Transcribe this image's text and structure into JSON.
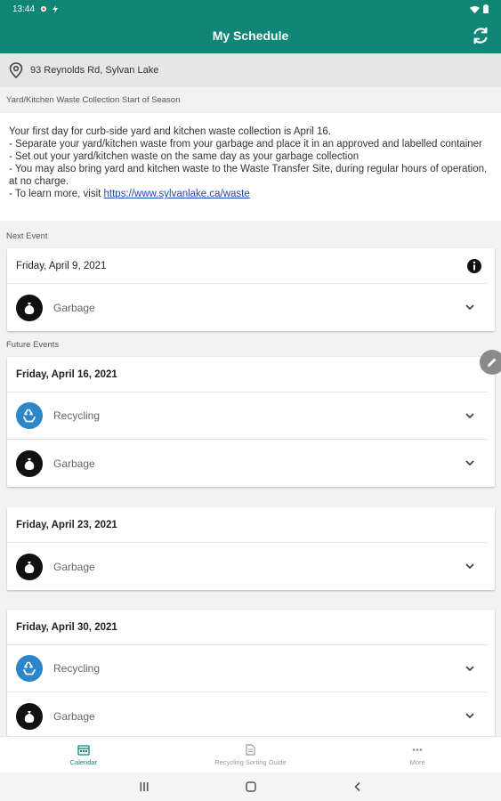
{
  "status": {
    "time": "13:44"
  },
  "appbar": {
    "title": "My Schedule"
  },
  "address": {
    "text": "93 Reynolds Rd, Sylvan Lake"
  },
  "notice": {
    "title": "Yard/Kitchen Waste Collection Start of Season",
    "lines": [
      "Your first day for curb-side yard and kitchen waste collection is April 16.",
      "- Separate your yard/kitchen waste from your garbage and place it in an approved and labelled container",
      "- Set out your yard/kitchen waste on the same day as your garbage collection",
      "- You may also bring yard and kitchen waste to the Waste Transfer Site, during regular hours of operation, at no charge."
    ],
    "learn_prefix": "- To learn more, visit ",
    "learn_link": "https://www.sylvanlake.ca/waste"
  },
  "next_event": {
    "label": "Next Event",
    "date": "Friday, April 9, 2021",
    "items": [
      {
        "type": "garbage",
        "label": "Garbage"
      }
    ]
  },
  "future_events": {
    "label": "Future Events",
    "events": [
      {
        "date": "Friday, April 16, 2021",
        "items": [
          {
            "type": "recycling",
            "label": "Recycling"
          },
          {
            "type": "garbage",
            "label": "Garbage"
          }
        ]
      },
      {
        "date": "Friday, April 23, 2021",
        "items": [
          {
            "type": "garbage",
            "label": "Garbage"
          }
        ]
      },
      {
        "date": "Friday, April 30, 2021",
        "items": [
          {
            "type": "recycling",
            "label": "Recycling"
          },
          {
            "type": "garbage",
            "label": "Garbage"
          }
        ]
      }
    ]
  },
  "bottom_nav": [
    {
      "label": "Calendar",
      "icon": "calendar-icon",
      "active": true
    },
    {
      "label": "Recycling Sorting Guide",
      "icon": "document-icon",
      "active": false
    },
    {
      "label": "More",
      "icon": "more-icon",
      "active": false
    }
  ],
  "colors": {
    "primary": "#0f8676",
    "recycling": "#2c86c9",
    "garbage": "#111111",
    "link": "#1a4db3"
  }
}
